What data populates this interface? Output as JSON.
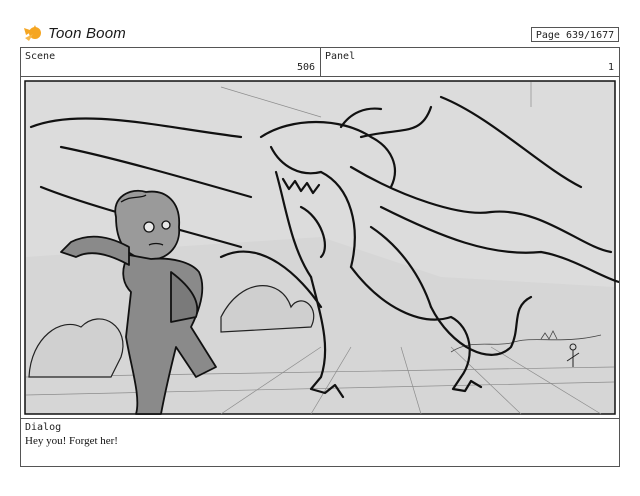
{
  "logo": {
    "brand": "Toon Boom",
    "icon": "toon-boom-star-icon",
    "color": "#f5a623"
  },
  "page": {
    "label": "Page",
    "value": "639/1677",
    "text": "Page  639/1677"
  },
  "scene": {
    "label": "Scene",
    "value": "506"
  },
  "panel": {
    "label": "Panel",
    "value": "1",
    "image": "storyboard-sketch-kid-and-dragon"
  },
  "dialog": {
    "label": "Dialog",
    "text": "Hey you! Forget her!"
  },
  "colors": {
    "frame": "#555555",
    "sketch_bg": "#d6d6d6",
    "figure": "#8a8a8a",
    "ink": "#111111"
  }
}
